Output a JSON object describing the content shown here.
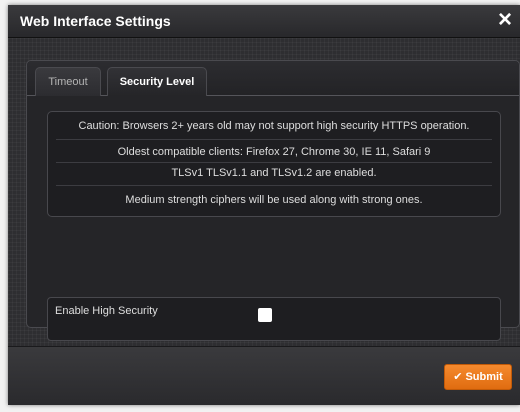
{
  "dialog": {
    "title": "Web Interface Settings",
    "close_icon": "×"
  },
  "tabs": [
    {
      "label": "Timeout",
      "active": false
    },
    {
      "label": "Security Level",
      "active": true
    }
  ],
  "info": {
    "lines": [
      "Caution: Browsers 2+ years old may not support high security HTTPS operation.",
      "Oldest compatible clients: Firefox 27, Chrome 30, IE 11, Safari 9",
      "TLSv1 TLSv1.1 and TLSv1.2 are enabled.",
      "Medium strength ciphers will be used along with strong ones."
    ]
  },
  "settings": {
    "high_security_label": "Enable High Security",
    "high_security_checked": false
  },
  "footer": {
    "submit_label": "Submit",
    "submit_icon": "✔"
  },
  "colors": {
    "accent": "#f07c1e",
    "background": "#2e2e31",
    "text": "#dedede"
  }
}
